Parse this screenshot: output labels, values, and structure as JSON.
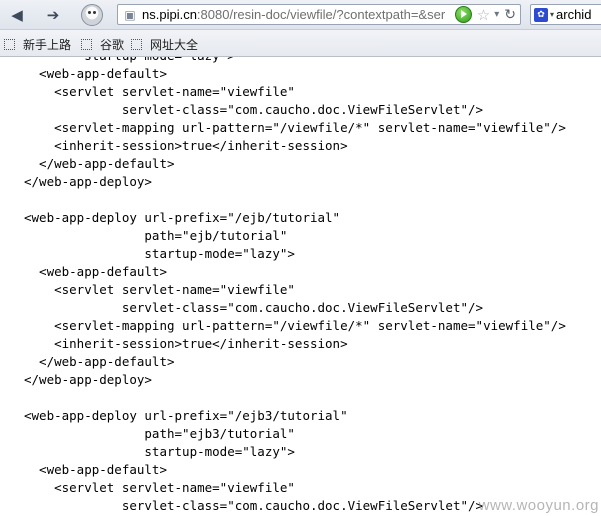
{
  "toolbar": {
    "back_icon": "back-arrow-icon",
    "forward_icon": "forward-arrow-icon",
    "user_icon": "user-profile-icon",
    "address": {
      "prefix": "",
      "host": "ns.pipi.cn",
      "rest": ":8080/resin-doc/viewfile/?contextpath=&ser"
    },
    "search": {
      "engine_icon": "baidu-paw-icon",
      "value": "archid"
    }
  },
  "bookmarks": [
    {
      "label": "新手上路"
    },
    {
      "label": "谷歌"
    },
    {
      "label": "网址大全"
    }
  ],
  "code_lines": [
    "        startup-mode=\"lazy\">",
    "  <web-app-default>",
    "    <servlet servlet-name=\"viewfile\"",
    "             servlet-class=\"com.caucho.doc.ViewFileServlet\"/>",
    "    <servlet-mapping url-pattern=\"/viewfile/*\" servlet-name=\"viewfile\"/>",
    "    <inherit-session>true</inherit-session>",
    "  </web-app-default>",
    "</web-app-deploy>",
    "",
    "<web-app-deploy url-prefix=\"/ejb/tutorial\"",
    "                path=\"ejb/tutorial\"",
    "                startup-mode=\"lazy\">",
    "  <web-app-default>",
    "    <servlet servlet-name=\"viewfile\"",
    "             servlet-class=\"com.caucho.doc.ViewFileServlet\"/>",
    "    <servlet-mapping url-pattern=\"/viewfile/*\" servlet-name=\"viewfile\"/>",
    "    <inherit-session>true</inherit-session>",
    "  </web-app-default>",
    "</web-app-deploy>",
    "",
    "<web-app-deploy url-prefix=\"/ejb3/tutorial\"",
    "                path=\"ejb3/tutorial\"",
    "                startup-mode=\"lazy\">",
    "  <web-app-default>",
    "    <servlet servlet-name=\"viewfile\"",
    "             servlet-class=\"com.caucho.doc.ViewFileServlet\"/>"
  ],
  "watermark": "www.wooyun.org"
}
